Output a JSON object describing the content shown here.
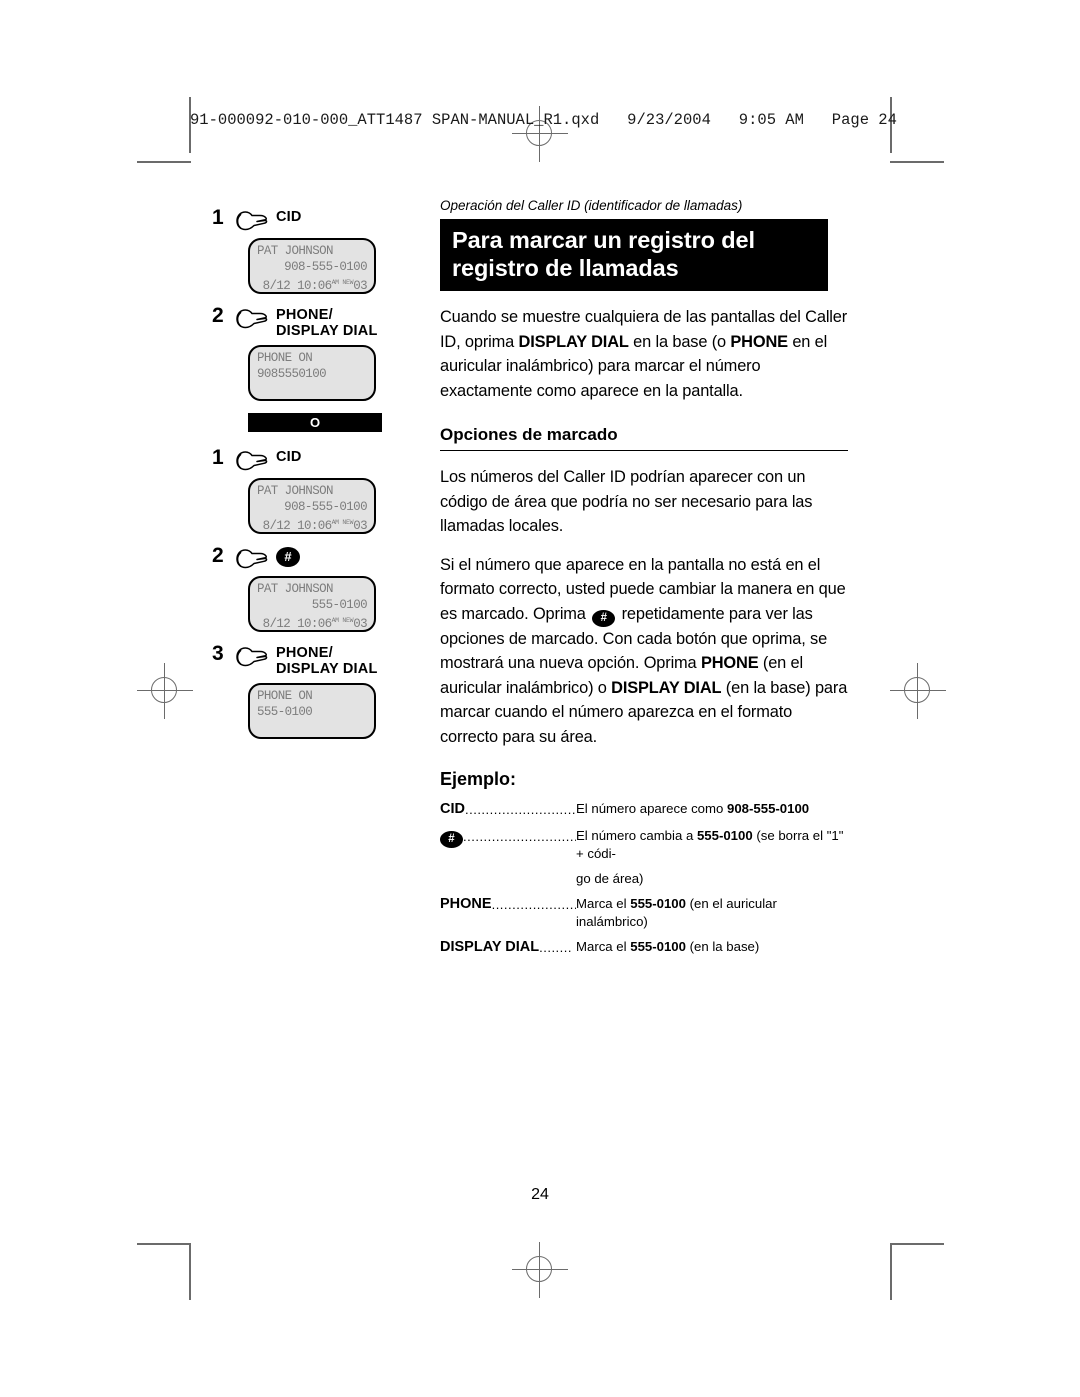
{
  "slug": {
    "text": "91-000092-010-000_ATT1487 SPAN-MANUAL_R1.qxd   9/23/2004   9:05 AM   Page 24"
  },
  "page": {
    "number": "24"
  },
  "running_head": "Operación del Caller ID (identificador de llamadas)",
  "title": "Para marcar un registro del registro de llamadas",
  "intro": {
    "part1": "Cuando se muestre cualquiera de las pantallas del Caller ID, oprima ",
    "bold1": "DISPLAY DIAL",
    "part2": " en la base (o ",
    "bold2": "PHONE",
    "part3": " en el auricular inalámbrico) para marcar el número exactamente como aparece en la pantalla."
  },
  "subhead": "Opciones de marcado",
  "para2": "Los números del Caller ID podrían aparecer con un código de área que podría no ser necesario para las llamadas locales.",
  "para3": {
    "part1": "Si el número que aparece en la pantalla no está en el formato correcto, usted puede cambiar la manera en que es marcado. Oprima ",
    "hash": "#",
    "part2": " repetidamente para ver las opciones de marcado. Con cada botón que oprima, se mostrará una nueva opción. Oprima ",
    "bold1": "PHONE",
    "part3": " (en el auricular inalámbrico) o ",
    "bold2": "DISPLAY DIAL",
    "part4": " (en la base) para marcar cuando el número aparezca en el formato correcto para su área."
  },
  "example": {
    "heading": "Ejemplo:",
    "rows": [
      {
        "key": "CID",
        "dots": "...............................",
        "value_pre": "El número aparece como ",
        "value_bold": "908-555-0100",
        "value_post": ""
      },
      {
        "key": "#",
        "key_is_hash": true,
        "dots": "..............................",
        "value_pre": "El número cambia a ",
        "value_bold": "555-0100",
        "value_post": " (se borra el \"1\" + códi-",
        "continuation": "go de área)"
      },
      {
        "key": "PHONE",
        "dots": ".....................",
        "value_pre": "Marca el ",
        "value_bold": "555-0100",
        "value_post": " (en el auricular inalámbrico)"
      },
      {
        "key": "DISPLAY DIAL",
        "dots": "........",
        "value_pre": "Marca el ",
        "value_bold": "555-0100",
        "value_post": " (en la base)"
      }
    ]
  },
  "sequence_a": {
    "steps": [
      {
        "num": "1",
        "button": "CID",
        "button_type": "text",
        "screen": {
          "line1": "PAT JOHNSON",
          "line2": "908-555-0100",
          "line3_time": "8/12 10:06",
          "line3_sup": "AM NEW",
          "line3_count": "03"
        }
      },
      {
        "num": "2",
        "button": "PHONE/\nDISPLAY DIAL",
        "button_type": "text",
        "screen": {
          "line1": "PHONE ON",
          "line2": "9085550100"
        }
      }
    ]
  },
  "divider": {
    "label": "O"
  },
  "sequence_b": {
    "steps": [
      {
        "num": "1",
        "button": "CID",
        "button_type": "text",
        "screen": {
          "line1": "PAT JOHNSON",
          "line2": "908-555-0100",
          "line3_time": "8/12 10:06",
          "line3_sup": "AM NEW",
          "line3_count": "03"
        }
      },
      {
        "num": "2",
        "button": "#",
        "button_type": "hash",
        "screen": {
          "line1": "PAT JOHNSON",
          "line2": "555-0100",
          "line3_time": "8/12 10:06",
          "line3_sup": "AM NEW",
          "line3_count": "03"
        }
      },
      {
        "num": "3",
        "button": "PHONE/\nDISPLAY DIAL",
        "button_type": "text",
        "screen": {
          "line1": "PHONE ON",
          "line2": "555-0100"
        }
      }
    ]
  },
  "colors": {
    "ink": "#000000",
    "lcd_bg": "#e3e3e3",
    "lcd_text": "#7d7d7d",
    "mark": "#6b6b6b"
  }
}
